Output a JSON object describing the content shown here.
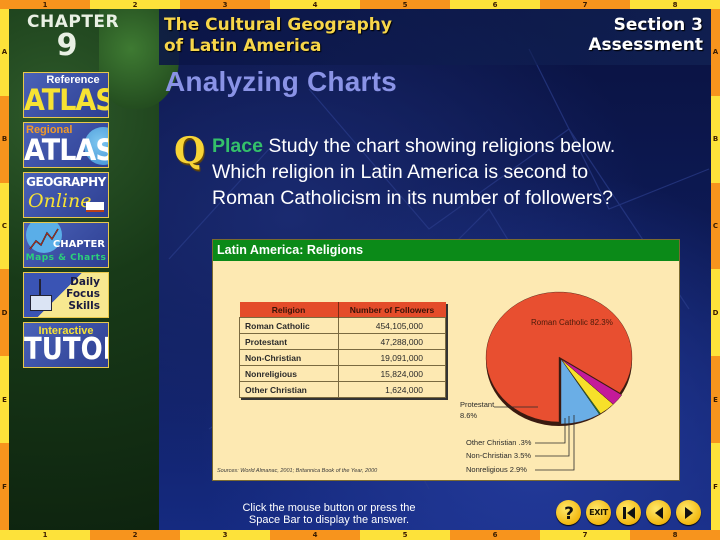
{
  "ruler": {
    "columns": [
      "1",
      "2",
      "3",
      "4",
      "5",
      "6",
      "7",
      "8"
    ],
    "rows": [
      "A",
      "B",
      "C",
      "D",
      "E",
      "F"
    ]
  },
  "header": {
    "chapter_label": "CHAPTER",
    "chapter_number": "9",
    "title_line1": "The Cultural Geography",
    "title_line2": "of Latin America",
    "section_line1": "Section 3",
    "section_line2": "Assessment"
  },
  "sidebar": {
    "items": [
      {
        "small": "Reference",
        "big": "ATLAS",
        "icon": "reference-atlas-icon"
      },
      {
        "small": "Regional",
        "big": "ATLAS",
        "icon": "regional-atlas-icon"
      },
      {
        "small": "GEOGRAPHY",
        "big": "Online",
        "icon": "geography-online-icon"
      },
      {
        "small": "CHAPTER",
        "big": "Maps & Charts",
        "icon": "chapter-maps-charts-icon"
      },
      {
        "small": "Daily\nFocus\nSkills",
        "big": "",
        "icon": "daily-focus-skills-icon"
      },
      {
        "small": "Interactive",
        "big": "TUTOR",
        "icon": "interactive-tutor-icon"
      }
    ]
  },
  "main": {
    "title": "Analyzing Charts",
    "q_glyph": "Q",
    "question_keyword": "Place",
    "question_text": " Study the chart showing religions below. Which religion in Latin America is second to Roman Catholicism in its number of followers?"
  },
  "chart_data": {
    "type": "pie",
    "title": "Latin America: Religions",
    "table": {
      "headers": [
        "Religion",
        "Number of Followers"
      ],
      "rows": [
        [
          "Roman Catholic",
          "454,105,000"
        ],
        [
          "Protestant",
          "47,288,000"
        ],
        [
          "Non-Christian",
          "19,091,000"
        ],
        [
          "Nonreligious",
          "15,824,000"
        ],
        [
          "Other Christian",
          "1,624,000"
        ]
      ]
    },
    "slices": [
      {
        "label": "Roman Catholic",
        "value": 82.3,
        "display": "Roman Catholic 82.3%",
        "color": "#e84f30"
      },
      {
        "label": "Protestant",
        "value": 8.6,
        "display": "Protestant\n8.6%",
        "color": "#6aaee6"
      },
      {
        "label": "Other Christian",
        "value": 0.3,
        "display": "Other Christian .3%",
        "color": "#108a4a"
      },
      {
        "label": "Non-Christian",
        "value": 3.5,
        "display": "Non-Christian 3.5%",
        "color": "#f7e02a"
      },
      {
        "label": "Nonreligious",
        "value": 2.9,
        "display": "Nonreligious 2.9%",
        "color": "#c41a9a"
      }
    ],
    "labels": {
      "roman_catholic": "Roman Catholic 82.3%",
      "protestant_1": "Protestant",
      "protestant_2": "8.6%",
      "other_christian": "Other Christian .3%",
      "non_christian": "Non-Christian 3.5%",
      "nonreligious": "Nonreligious 2.9%"
    },
    "source": "Sources: World Almanac, 2001; Britannica Book of the Year, 2000"
  },
  "footer": {
    "instruction_line1": "Click the mouse button or press the",
    "instruction_line2": "Space Bar to display the answer.",
    "exit_label": "EXIT"
  },
  "colors": {
    "accent_yellow": "#f7d64a",
    "title_periwinkle": "#8a93e6",
    "place_green": "#34c06a",
    "chart_header_green": "#0b8a18",
    "chart_bg": "#fde9b2"
  }
}
